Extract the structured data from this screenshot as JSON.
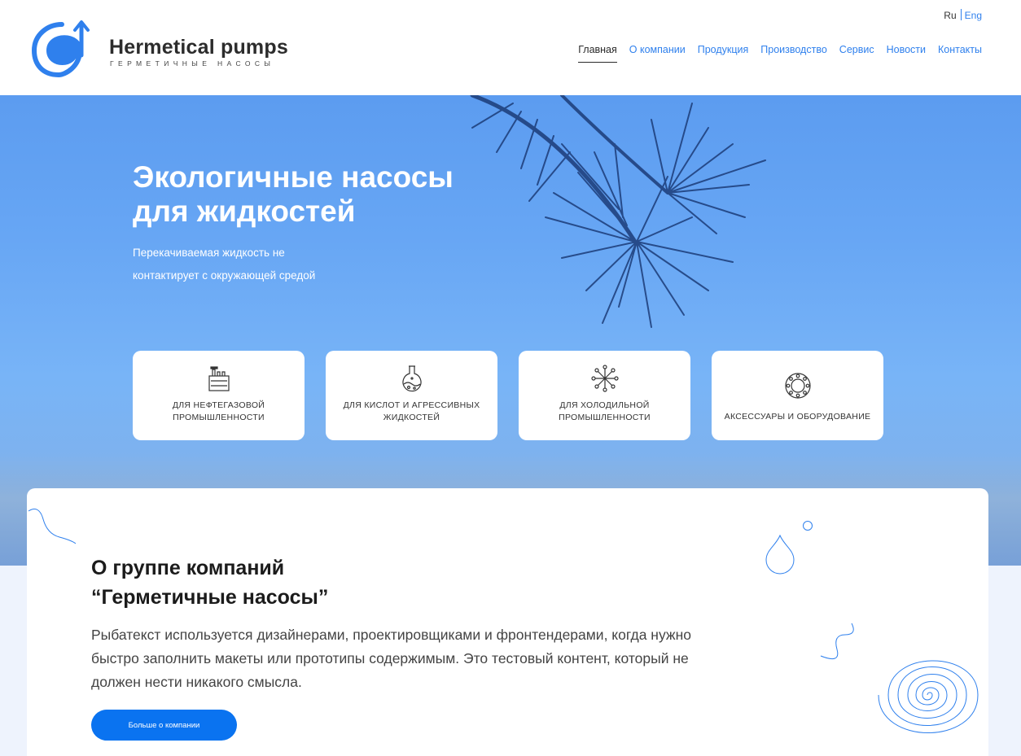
{
  "brand": {
    "title": "Hermetical pumps",
    "subtitle": "ГЕРМЕТИЧНЫЕ НАСОСЫ"
  },
  "lang": {
    "ru": "Ru",
    "en": "Eng"
  },
  "nav": [
    "Главная",
    "О компании",
    "Продукция",
    "Производство",
    "Сервис",
    "Новости",
    "Контакты"
  ],
  "hero": {
    "title_line1": "Экологичные насосы",
    "title_line2": "для жидкостей",
    "sub_line1": "Перекачиваемая жидкость не",
    "sub_line2": "контактирует с окружающей средой"
  },
  "cards": [
    {
      "label": "Для нефтегазовой промышленности",
      "icon": "factory-icon"
    },
    {
      "label": "Для кислот и агрессивных жидкостей",
      "icon": "flask-icon"
    },
    {
      "label": "Для холодильной промышленности",
      "icon": "snowflake-icon"
    },
    {
      "label": "Аксессуары и оборудование",
      "icon": "flange-icon"
    }
  ],
  "about": {
    "title_line1": "О группе компаний",
    "title_line2": "“Герметичные насосы”",
    "text": "Рыбатекст используется дизайнерами, проектировщиками и фронтендерами, когда нужно быстро заполнить макеты или прототипы содержимым. Это тестовый контент, который не должен нести никакого смысла.",
    "button": "Больше о компании"
  },
  "colors": {
    "accent": "#2f80ed",
    "button": "#0a73f0",
    "hero": "#67a6f4"
  }
}
